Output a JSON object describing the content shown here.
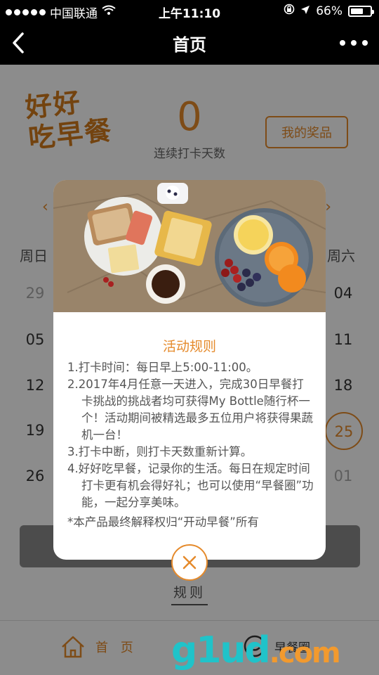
{
  "status_bar": {
    "carrier": "中国联通",
    "time": "上午11:10",
    "battery_percent": "66%",
    "battery_level": 0.66
  },
  "nav": {
    "title": "首页"
  },
  "header": {
    "logo_line1": "好好",
    "logo_line2": "吃早餐",
    "streak_count": "0",
    "streak_label": "连续打卡天数",
    "prize_button": "我的奖品"
  },
  "calendar": {
    "weekday_first": "周日",
    "weekday_last": "周六",
    "left_column": [
      "29",
      "05",
      "12",
      "19",
      "26"
    ],
    "right_column": [
      "04",
      "11",
      "18",
      "25",
      "01"
    ],
    "today": "25"
  },
  "rules_link": "规则",
  "tab_bar": {
    "home_label": "首 页",
    "circle_label": "早餐圈"
  },
  "watermark": {
    "main": "g1ud",
    "suffix": ".com"
  },
  "modal": {
    "title": "活动规则",
    "rules": [
      "1.打卡时间：每日早上5:00-11:00。",
      "2.2017年4月任意一天进入，完成30日早餐打卡挑战的挑战者均可获得My Bottle随行杯一个！活动期间被精选最多五位用户将获得果蔬机一台！",
      "3.打卡中断，则打卡天数重新计算。",
      "4.好好吃早餐，记录你的生活。每日在规定时间打卡更有机会得好礼；也可以使用“早餐圈”功能，一起分享美味。"
    ],
    "footer": "*本产品最终解释权归“开动早餐”所有"
  },
  "colors": {
    "accent": "#e58a2b",
    "bar": "#000000",
    "overlay": "rgba(0,0,0,0.45)"
  }
}
